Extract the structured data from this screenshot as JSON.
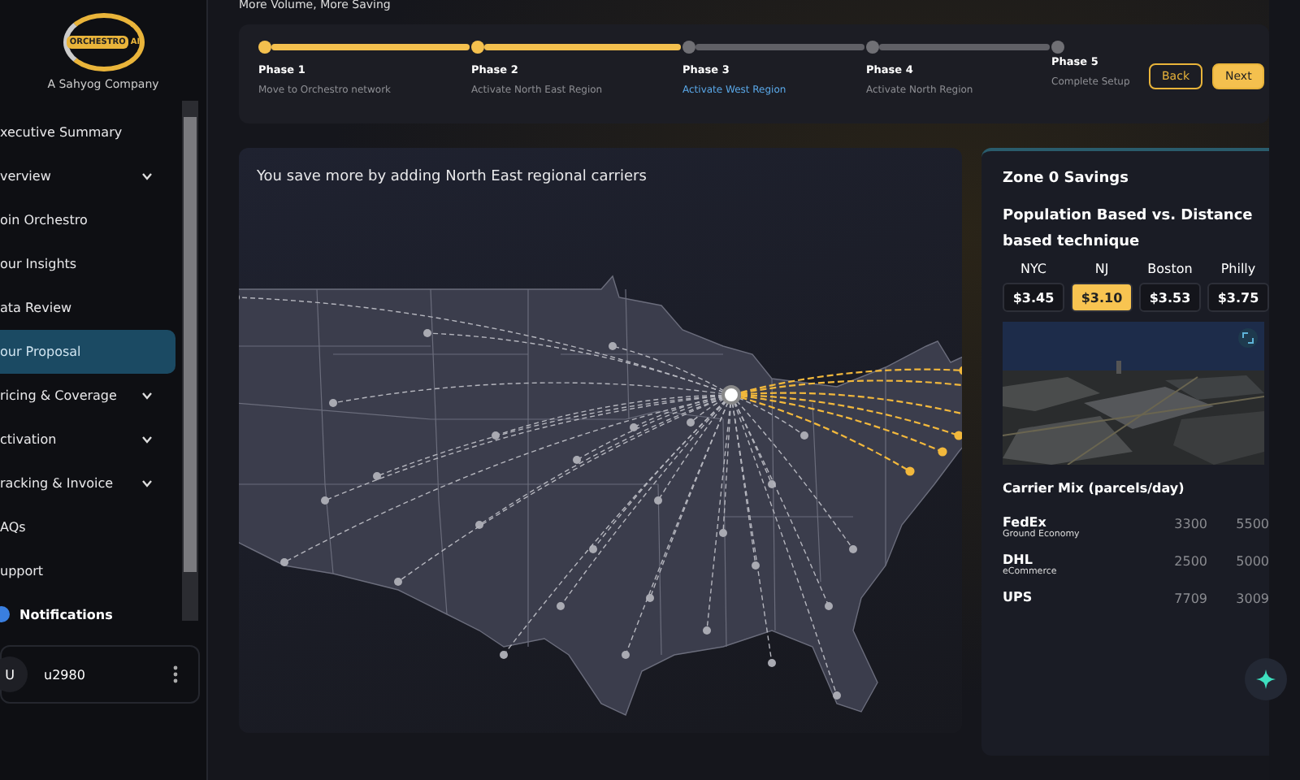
{
  "sidebar": {
    "logo": {
      "name": "ORCHESTRO",
      "suffix": "AI"
    },
    "company": "A Sahyog Company",
    "items": [
      {
        "label": "xecutive Summary",
        "kind": "link",
        "selected": false
      },
      {
        "label": "verview",
        "kind": "group",
        "selected": false
      },
      {
        "label": "oin Orchestro",
        "kind": "link",
        "selected": false
      },
      {
        "label": "our Insights",
        "kind": "link",
        "selected": false
      },
      {
        "label": "ata Review",
        "kind": "link",
        "selected": false
      },
      {
        "label": "our Proposal",
        "kind": "link",
        "selected": true
      },
      {
        "label": "ricing & Coverage",
        "kind": "group",
        "selected": false
      },
      {
        "label": "ctivation",
        "kind": "group",
        "selected": false
      },
      {
        "label": "racking & Invoice",
        "kind": "group",
        "selected": false
      },
      {
        "label": "AQs",
        "kind": "link",
        "selected": false
      },
      {
        "label": "upport",
        "kind": "link",
        "selected": false
      }
    ],
    "notifications": "Notifications",
    "user": {
      "initial": "U",
      "name": "u2980"
    }
  },
  "page_title": "More Volume, More Saving",
  "stepper": {
    "phases": [
      {
        "title": "Phase 1",
        "subtitle": "Move to Orchestro network",
        "done": true,
        "current": false
      },
      {
        "title": "Phase 2",
        "subtitle": "Activate North East Region",
        "done": true,
        "current": false
      },
      {
        "title": "Phase 3",
        "subtitle": "Activate West Region",
        "done": false,
        "current": true
      },
      {
        "title": "Phase 4",
        "subtitle": "Activate North Region",
        "done": false,
        "current": false
      },
      {
        "title": "Phase 5",
        "subtitle": "Complete Setup",
        "done": false,
        "current": false
      }
    ],
    "buttons": [
      "Back",
      "Next"
    ]
  },
  "map_card": {
    "title": "You save more by adding North East regional carriers"
  },
  "savings": {
    "title": "Zone 0 Savings",
    "subtitle": "Population Based vs. Distance based technique",
    "prices": [
      {
        "city": "NYC",
        "price": "$3.45",
        "selected": false
      },
      {
        "city": "NJ",
        "price": "$3.10",
        "selected": true
      },
      {
        "city": "Boston",
        "price": "$3.53",
        "selected": false
      },
      {
        "city": "Philly",
        "price": "$3.75",
        "selected": false
      }
    ],
    "carrier_title": "Carrier Mix (parcels/day)",
    "carriers": [
      {
        "name": "FedEx",
        "service": "Ground Economy",
        "values": [
          "3300",
          "5500"
        ]
      },
      {
        "name": "DHL",
        "service": "eCommerce",
        "values": [
          "2500",
          "5000"
        ]
      },
      {
        "name": "UPS",
        "values": [
          "7709",
          "3009"
        ]
      }
    ]
  }
}
